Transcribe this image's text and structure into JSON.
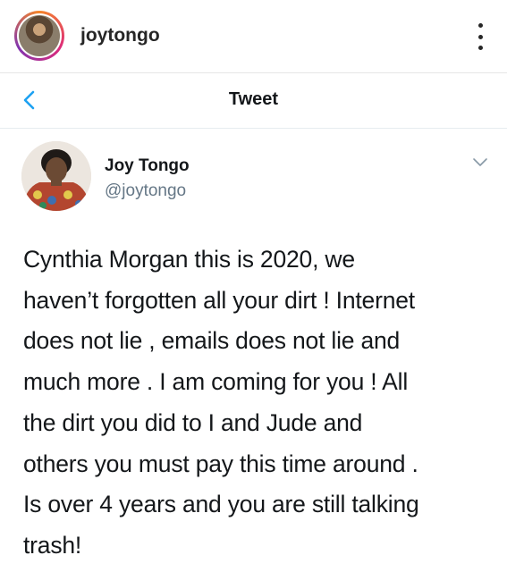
{
  "instagram_header": {
    "username": "joytongo",
    "avatar_icon": "profile-photo",
    "more_icon": "more-vertical-icon"
  },
  "tweet_bar": {
    "back_icon": "chevron-left-icon",
    "title": "Tweet"
  },
  "tweet": {
    "author_name": "Joy Tongo",
    "author_handle": "@joytongo",
    "menu_icon": "chevron-down-icon",
    "text": "Cynthia Morgan this is 2020, we\nhaven’t forgotten all your dirt ! Internet\ndoes not lie , emails does not lie and\nmuch more . I am coming for you ! All\nthe dirt you did to I and Jude and\nothers you must pay this time around .\nIs over 4 years and you are still talking\ntrash!"
  },
  "colors": {
    "link_blue": "#1da1f2",
    "text_primary": "#14171a",
    "text_secondary": "#657786"
  }
}
